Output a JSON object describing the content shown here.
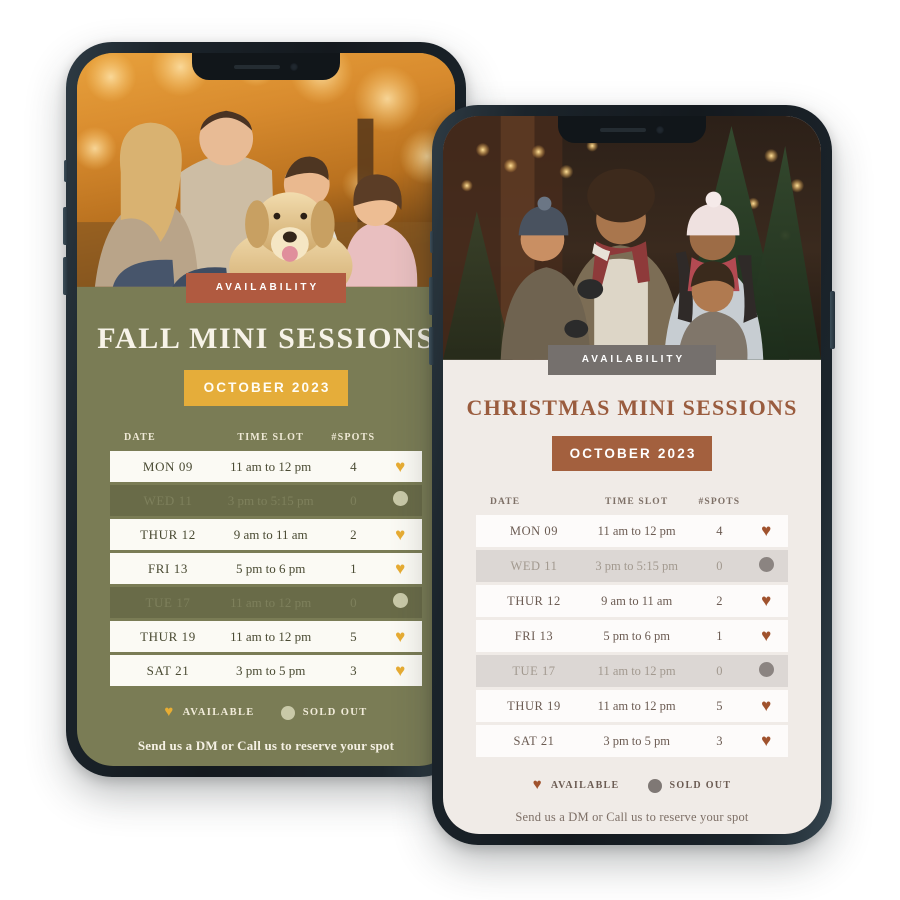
{
  "colors": {
    "fall_bg": "#7A7C55",
    "fall_row_sold": "#696B48",
    "fall_accent_button": "#E5AD3A",
    "fall_badge": "#B05A40",
    "fall_heart": "#E8AD33",
    "xmas_bg": "#F0EBE7",
    "xmas_row_sold": "#DCD7D4",
    "xmas_accent_button": "#A3603E",
    "xmas_badge": "#75706D",
    "xmas_heart": "#A0522D",
    "phone_frame": "#1B242B"
  },
  "table_headers": [
    "DATE",
    "TIME SLOT",
    "#SPOTS"
  ],
  "rows": [
    {
      "date": "MON 09",
      "time": "11 am to 12 pm",
      "spots": "4",
      "status": "available"
    },
    {
      "date": "WED 11",
      "time": "3 pm to 5:15 pm",
      "spots": "0",
      "status": "sold"
    },
    {
      "date": "THUR 12",
      "time": "9 am to 11 am",
      "spots": "2",
      "status": "available"
    },
    {
      "date": "FRI 13",
      "time": "5 pm to 6 pm",
      "spots": "1",
      "status": "available"
    },
    {
      "date": "TUE 17",
      "time": "11 am to 12 pm",
      "spots": "0",
      "status": "sold"
    },
    {
      "date": "THUR 19",
      "time": "11 am to 12 pm",
      "spots": "5",
      "status": "available"
    },
    {
      "date": "SAT 21",
      "time": "3 pm to 5 pm",
      "spots": "3",
      "status": "available"
    }
  ],
  "fall_phone": {
    "badge_label": "AVAILABILITY",
    "title": "FALL MINI SESSIONS",
    "month_label": "OCTOBER 2023",
    "legend_available": "AVAILABLE",
    "legend_sold_out": "SOLD OUT",
    "footnote": "Send us a DM or Call us to reserve your spot",
    "hero_alt": "family-with-golden-retriever-autumn-photo"
  },
  "xmas_phone": {
    "badge_label": "AVAILABILITY",
    "title": "CHRISTMAS MINI SESSIONS",
    "month_label": "OCTOBER 2023",
    "legend_available": "AVAILABLE",
    "legend_sold_out": "SOLD OUT",
    "footnote": "Send us a DM or Call us to reserve your spot",
    "hero_alt": "family-at-christmas-tree-lot-photo"
  },
  "icons": {
    "heart": "♥",
    "dot": "●"
  }
}
